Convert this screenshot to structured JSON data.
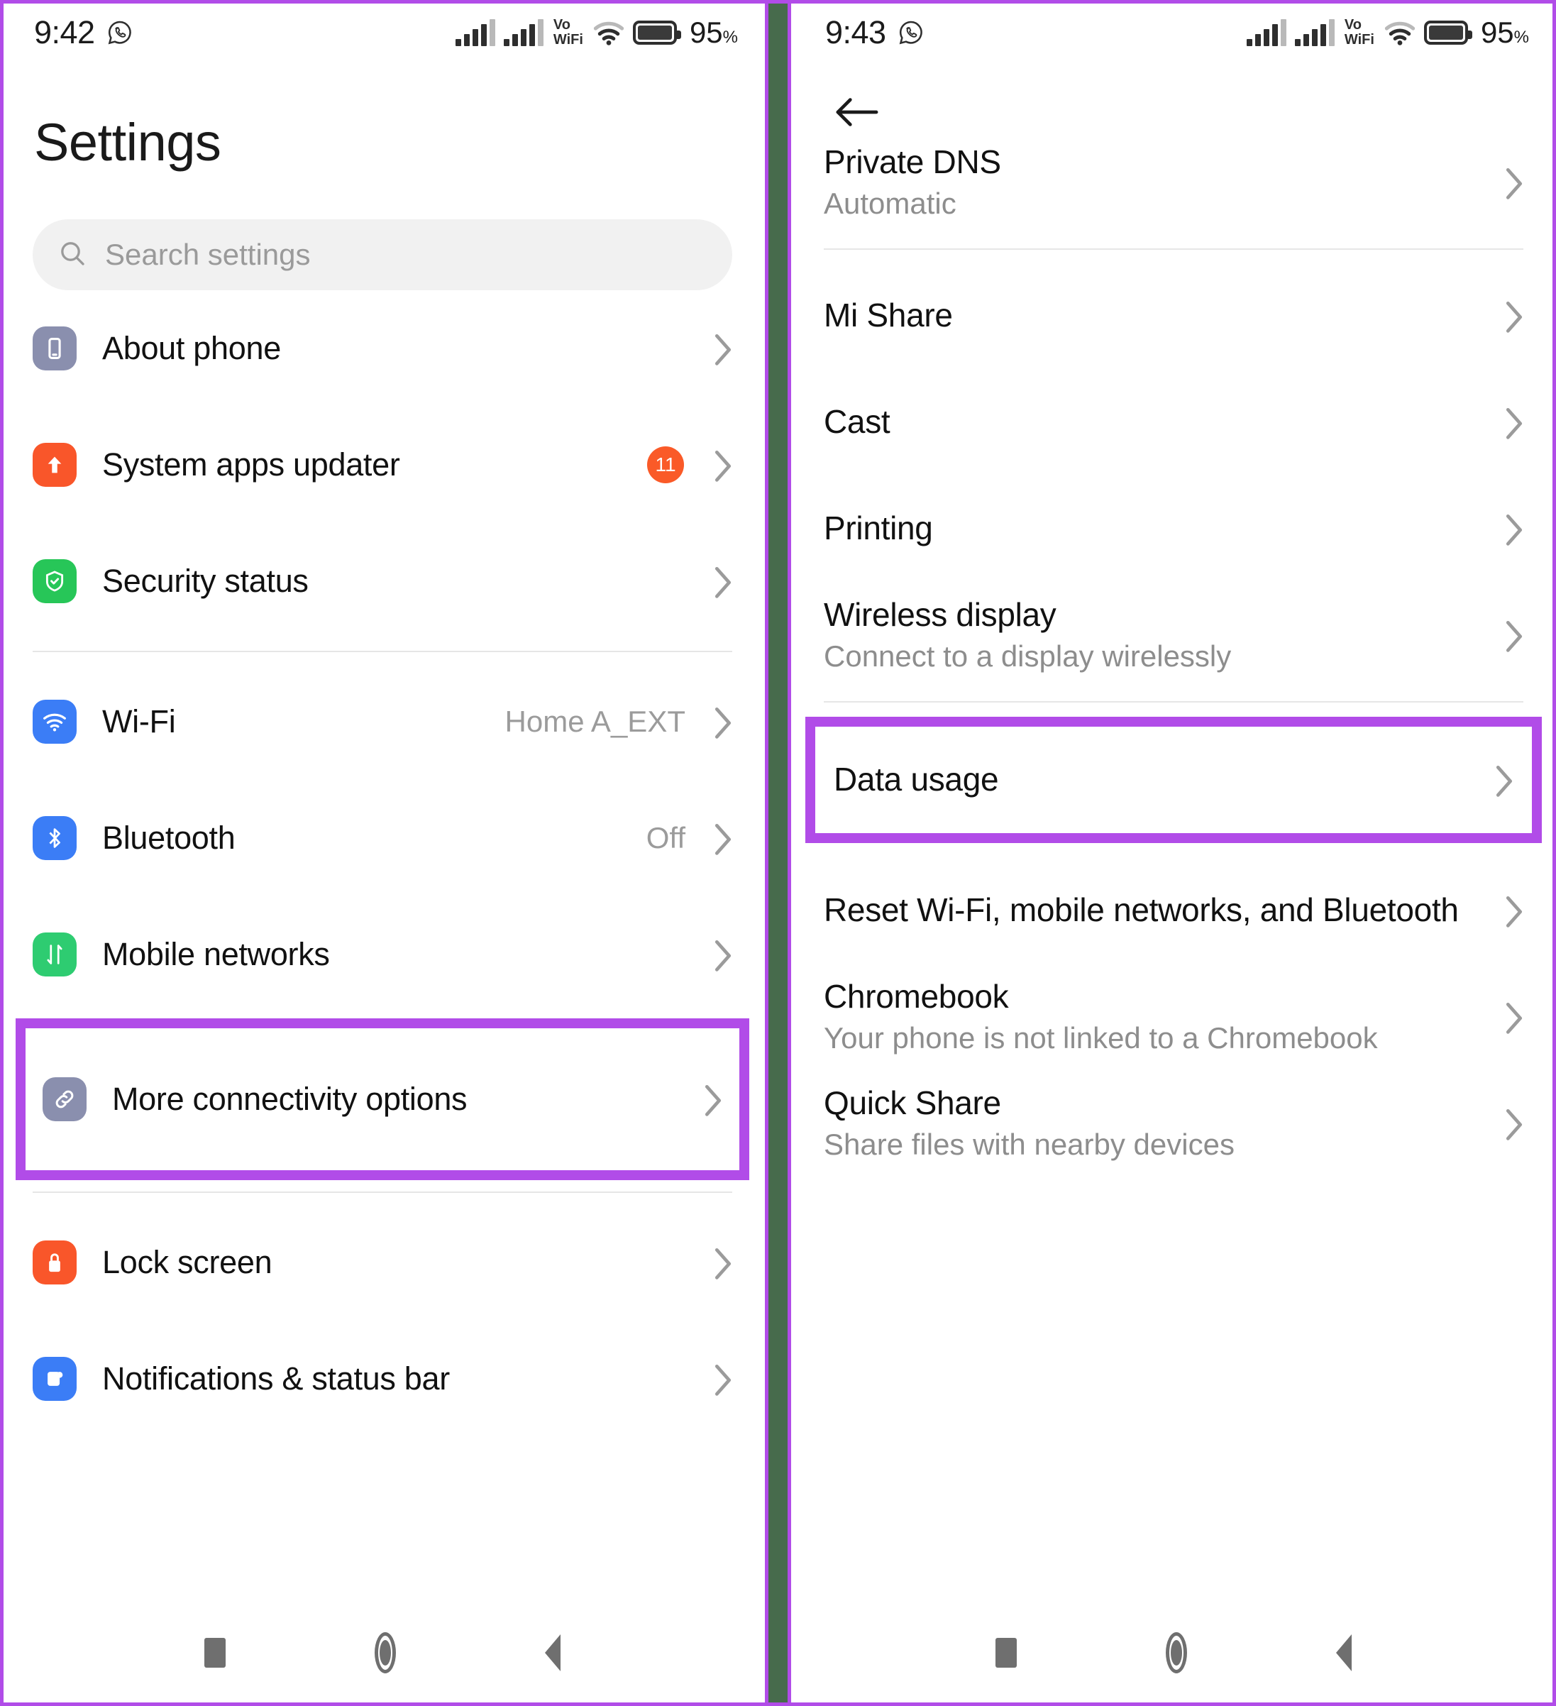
{
  "status_bar_left": {
    "time": "9:42",
    "app_icon": "whatsapp-icon"
  },
  "status_bar_right": {
    "time": "9:43",
    "app_icon": "whatsapp-icon"
  },
  "status_icons": {
    "volte_wifi": [
      "Vo",
      "WiFi"
    ],
    "battery_percent": "95",
    "percent_symbol": "%"
  },
  "left_screen": {
    "title": "Settings",
    "search": {
      "placeholder": "Search settings",
      "icon": "search-icon"
    },
    "groups": [
      {
        "items": [
          {
            "label": "About phone",
            "icon": "phone-icon",
            "icon_color": "#8a8fae",
            "value": "",
            "badge": "",
            "chevron": true
          },
          {
            "label": "System apps updater",
            "icon": "up-arrow-icon",
            "icon_color": "#f9562a",
            "value": "",
            "badge": "11",
            "chevron": true
          },
          {
            "label": "Security status",
            "icon": "shield-check-icon",
            "icon_color": "#27c658",
            "value": "",
            "badge": "",
            "chevron": true
          }
        ]
      },
      {
        "items": [
          {
            "label": "Wi-Fi",
            "icon": "wifi-icon",
            "icon_color": "#3b7df6",
            "value": "Home A_EXT",
            "badge": "",
            "chevron": true
          },
          {
            "label": "Bluetooth",
            "icon": "bluetooth-icon",
            "icon_color": "#3b7df6",
            "value": "Off",
            "badge": "",
            "chevron": true
          },
          {
            "label": "Mobile networks",
            "icon": "data-transfer-icon",
            "icon_color": "#2ecc71",
            "value": "",
            "badge": "",
            "chevron": true
          }
        ]
      },
      {
        "highlighted": true,
        "items": [
          {
            "label": "More connectivity options",
            "icon": "link-icon",
            "icon_color": "#8a8fae",
            "value": "",
            "badge": "",
            "chevron": true
          }
        ]
      },
      {
        "items": [
          {
            "label": "Lock screen",
            "icon": "lock-icon",
            "icon_color": "#f9562a",
            "value": "",
            "badge": "",
            "chevron": true
          },
          {
            "label": "Notifications & status bar",
            "icon": "notification-icon",
            "icon_color": "#3b7df6",
            "value": "",
            "badge": "",
            "chevron": true
          }
        ]
      }
    ]
  },
  "right_screen": {
    "back_icon": "back-arrow-icon",
    "groups": [
      {
        "items": [
          {
            "title": "Private DNS",
            "subtitle": "Automatic",
            "clipped": true,
            "chevron": true
          }
        ]
      },
      {
        "items": [
          {
            "title": "Mi Share",
            "subtitle": "",
            "chevron": true
          },
          {
            "title": "Cast",
            "subtitle": "",
            "chevron": true
          },
          {
            "title": "Printing",
            "subtitle": "",
            "chevron": true
          },
          {
            "title": "Wireless display",
            "subtitle": "Connect to a display wirelessly",
            "chevron": true
          }
        ]
      },
      {
        "highlighted": true,
        "items": [
          {
            "title": "Data usage",
            "subtitle": "",
            "chevron": true
          }
        ]
      },
      {
        "items": [
          {
            "title": "Reset Wi-Fi, mobile networks, and Bluetooth",
            "subtitle": "",
            "chevron": true
          },
          {
            "title": "Chromebook",
            "subtitle": "Your phone is not linked to a Chromebook",
            "chevron": true
          },
          {
            "title": "Quick Share",
            "subtitle": "Share files with nearby devices",
            "chevron": true
          }
        ]
      }
    ]
  },
  "nav_bar": {
    "recents": "recents-square-icon",
    "home": "home-circle-icon",
    "back": "back-triangle-icon"
  },
  "colors": {
    "highlight": "#b14ce8",
    "divider": "#476b4c",
    "badge": "#fa5a28"
  }
}
